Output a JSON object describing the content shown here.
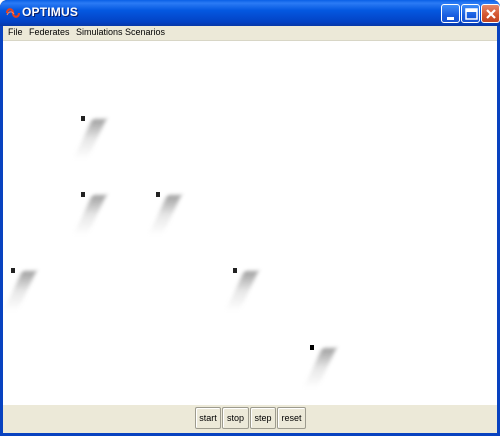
{
  "window": {
    "title": "OPTIMUS",
    "title_color": "#ffffff",
    "titlebar_color": "#0458e0"
  },
  "menu": {
    "items": [
      "File",
      "Federates",
      "Simulations",
      "Scenarios"
    ]
  },
  "controls": {
    "start": "start",
    "stop": "stop",
    "step": "step",
    "reset": "reset"
  },
  "canvas": {
    "background": "#ffffff",
    "agent_color": "#222222",
    "agent_count": 6
  },
  "icons": {
    "app": "optimus-app-icon",
    "minimize": "minimize-icon",
    "maximize": "maximize-icon",
    "close": "close-icon"
  }
}
